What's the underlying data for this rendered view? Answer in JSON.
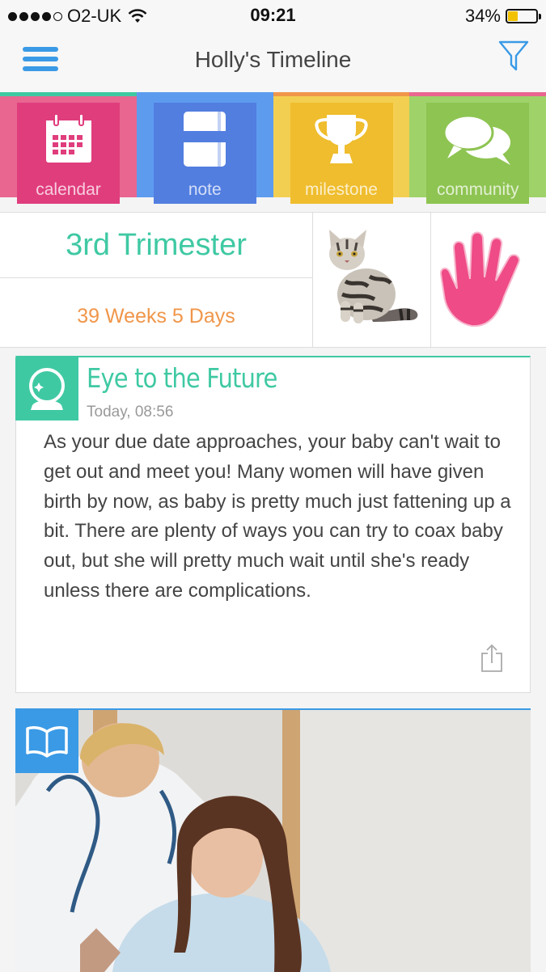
{
  "status_bar": {
    "carrier": "O2-UK",
    "time": "09:21",
    "battery": "34%",
    "battery_level": 0.34,
    "signal_bars": 4
  },
  "header": {
    "title": "Holly's Timeline"
  },
  "tiles": [
    {
      "label": "calendar",
      "icon": "calendar-icon",
      "color": "#e03d7d",
      "bg": "#e86690"
    },
    {
      "label": "note",
      "icon": "note-icon",
      "color": "#527ee0",
      "bg": "#5d9bef"
    },
    {
      "label": "milestone",
      "icon": "trophy-icon",
      "color": "#efbd2d",
      "bg": "#f3cf51"
    },
    {
      "label": "community",
      "icon": "chat-bubbles-icon",
      "color": "#8ec452",
      "bg": "#9fd269"
    }
  ],
  "pregnancy": {
    "trimester": "3rd Trimester",
    "duration": "39 Weeks 5 Days"
  },
  "article": {
    "title": "Eye to the Future",
    "timestamp": "Today, 08:56",
    "body": "As your due date approaches, your baby can't wait to get out and meet you! Many women will have given birth by now, as baby is pretty much just fattening up a bit. There are plenty of ways you can try to coax baby out, but she will pretty much wait until she's ready unless there are complications.",
    "icon": "crystal-ball-icon",
    "accent": "#3fc9a3"
  },
  "image_card": {
    "icon": "book-icon",
    "accent": "#3a9ae6"
  },
  "colors": {
    "accent_blue": "#3a9ae6",
    "trimester_green": "#3fc9a3",
    "weeks_orange": "#f0964a",
    "hand_pink": "#ef4b86"
  }
}
